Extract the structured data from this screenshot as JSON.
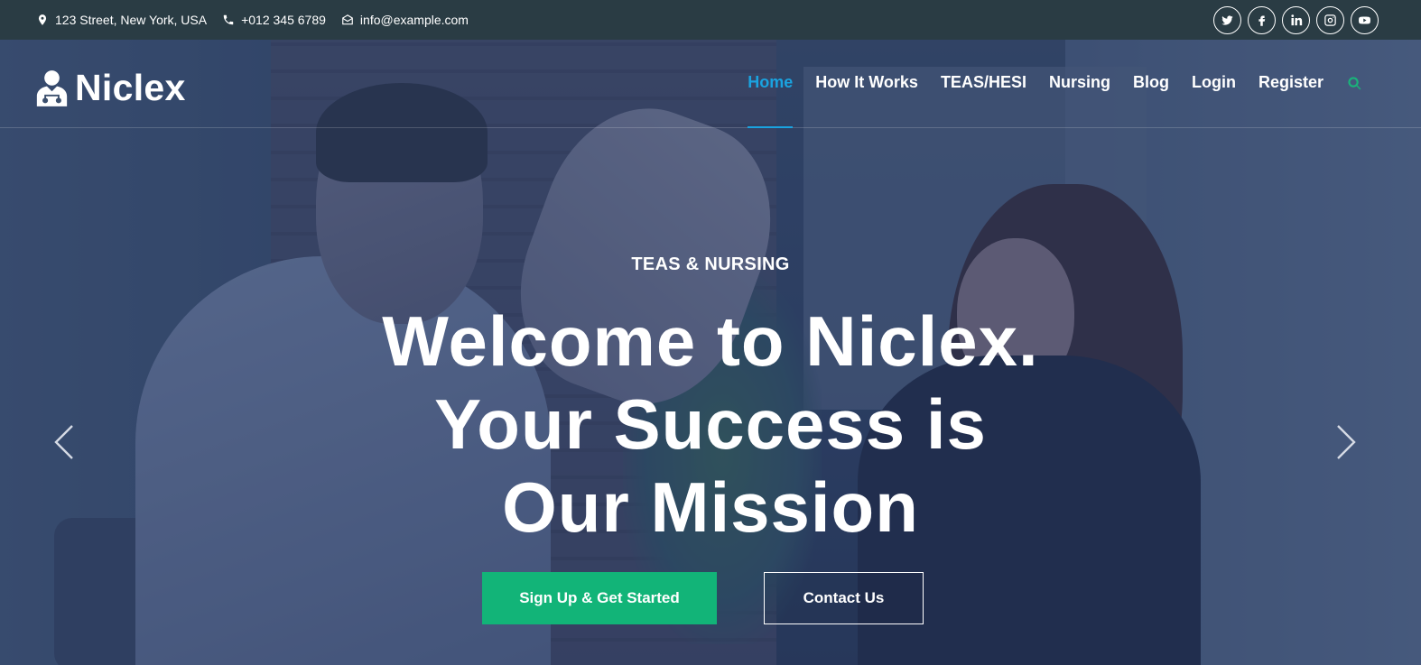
{
  "topbar": {
    "address": "123 Street, New York, USA",
    "phone": "+012 345 6789",
    "email": "info@example.com",
    "socials": [
      "twitter-icon",
      "facebook-icon",
      "linkedin-icon",
      "instagram-icon",
      "youtube-icon"
    ]
  },
  "brand": {
    "name": "Niclex",
    "icon": "doctor-icon"
  },
  "nav": {
    "items": [
      {
        "label": "Home",
        "active": true
      },
      {
        "label": "How It Works"
      },
      {
        "label": "TEAS/HESI"
      },
      {
        "label": "Nursing"
      },
      {
        "label": "Blog"
      },
      {
        "label": "Login"
      },
      {
        "label": "Register"
      }
    ],
    "search_icon": "search-icon"
  },
  "hero": {
    "eyebrow": "TEAS & NURSING",
    "headline": [
      "Welcome to Niclex.",
      "Your Success is",
      "Our Mission"
    ],
    "primary_button": "Sign Up & Get Started",
    "secondary_button": "Contact Us"
  },
  "colors": {
    "topbar_bg": "#2a3c44",
    "nav_active": "#1aa3e0",
    "primary_button": "#12b478",
    "search_icon": "#19b47a"
  }
}
